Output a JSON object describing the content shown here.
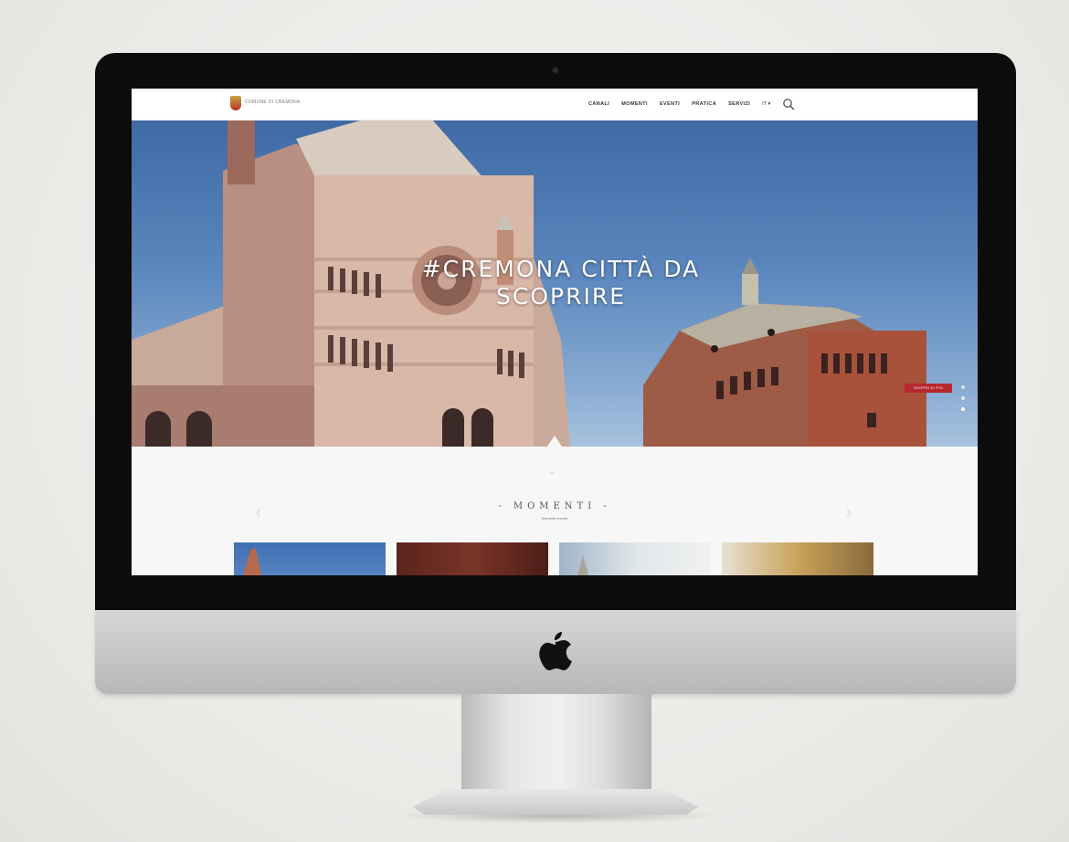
{
  "website": {
    "header": {
      "logo_text": "COMUNE DI CREMONA",
      "nav": [
        "CANALI",
        "MOMENTI",
        "EVENTI",
        "PRATICA",
        "SERVIZI"
      ],
      "language": "IT ▾"
    },
    "hero": {
      "title_line1": "#CREMONA CITTÀ DA",
      "title_line2": "SCOPRIRE",
      "tag": "SCOPRI DI PIÙ"
    },
    "section": {
      "title": "- MOMENTI -",
      "subtitle": "Momenti recenti"
    }
  },
  "colors": {
    "accent": "#b7282e",
    "sky": "#4f7bb5",
    "bezel": "#0c0c0c"
  },
  "icons": [
    "search-icon",
    "apple-logo-icon",
    "arrow-left-icon",
    "arrow-right-icon"
  ]
}
